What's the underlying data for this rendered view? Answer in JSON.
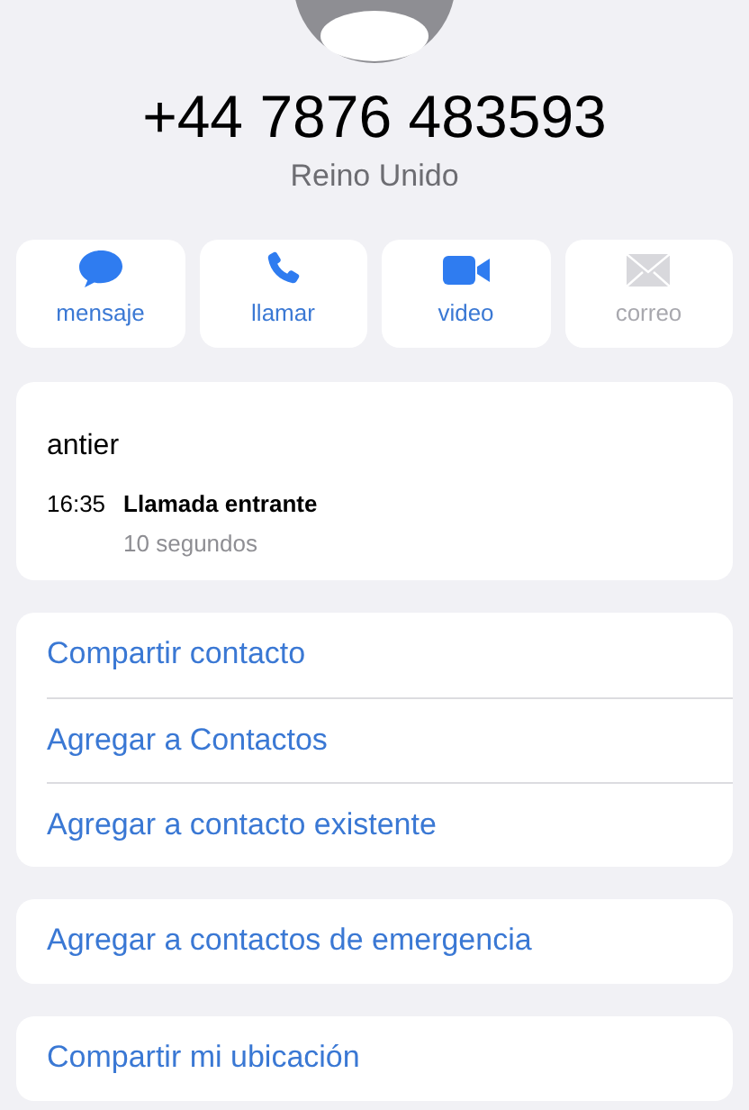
{
  "contact": {
    "phone": "+44 7876 483593",
    "country": "Reino Unido"
  },
  "actions": [
    {
      "kind": "message",
      "label": "mensaje",
      "disabled": false
    },
    {
      "kind": "call",
      "label": "llamar",
      "disabled": false
    },
    {
      "kind": "video",
      "label": "video",
      "disabled": false
    },
    {
      "kind": "mail",
      "label": "correo",
      "disabled": true
    }
  ],
  "call_log": {
    "date": "antier",
    "entries": [
      {
        "time": "16:35",
        "type": "Llamada entrante",
        "duration": "10 segundos"
      }
    ]
  },
  "option_groups": [
    [
      "Compartir contacto",
      "Agregar a Contactos",
      "Agregar a contacto existente"
    ],
    [
      "Agregar a contactos de emergencia"
    ],
    [
      "Compartir mi ubicación"
    ]
  ]
}
